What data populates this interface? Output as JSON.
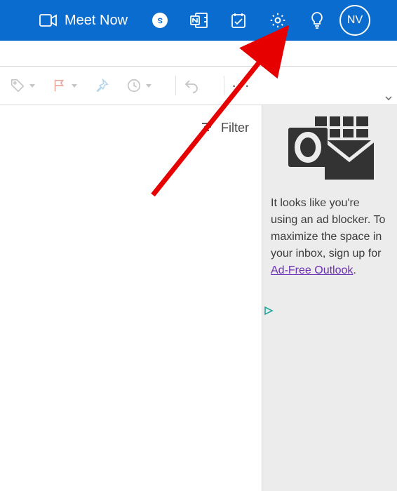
{
  "header": {
    "meet_now_label": "Meet Now",
    "avatar_initials": "NV",
    "icons": {
      "camera": "camera-icon",
      "skype": "skype-icon",
      "notes": "onenote-icon",
      "todo": "todo-icon",
      "settings": "settings-gear-icon",
      "tips": "lightbulb-icon"
    }
  },
  "toolbar": {
    "items": {
      "tag": "tag-icon",
      "flag": "flag-icon",
      "pin": "pin-icon",
      "snooze": "clock-icon",
      "undo": "undo-icon",
      "more": "···"
    }
  },
  "list": {
    "filter_label": "Filter"
  },
  "sidebar": {
    "message_line1": "It looks like you're using an ad blocker. To maximize the space in your inbox, sign up for ",
    "link_text": "Ad-Free Outlook",
    "message_tail": "."
  },
  "annotation": {
    "target": "settings-gear-icon"
  }
}
